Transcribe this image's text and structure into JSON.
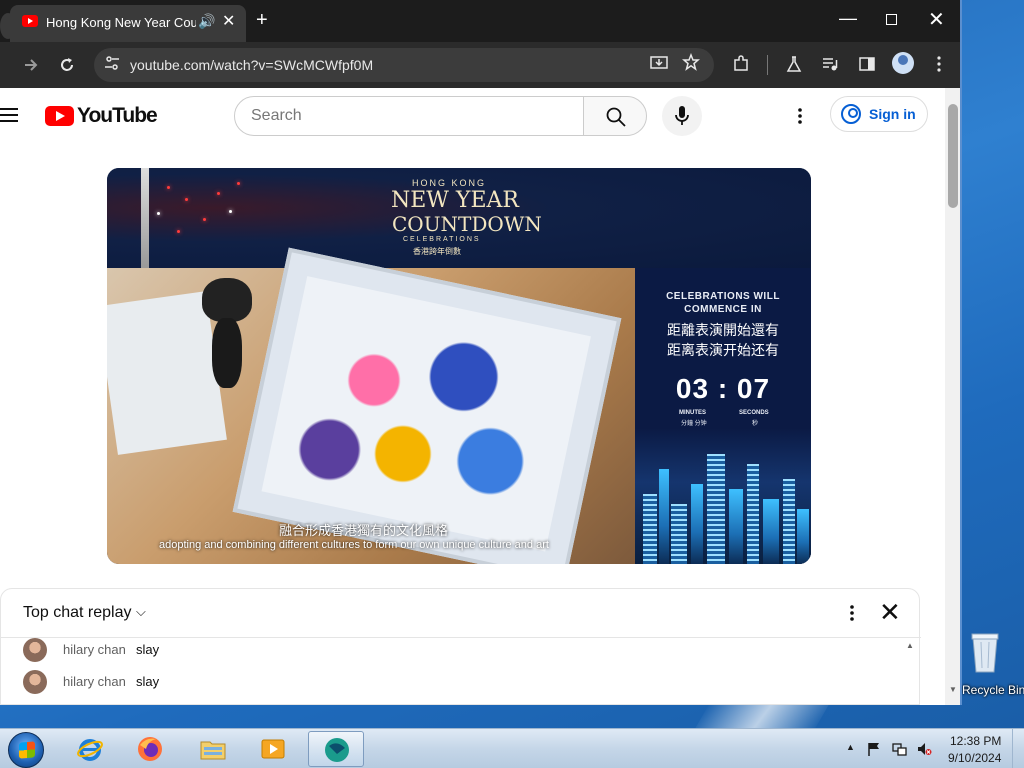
{
  "browser": {
    "tab_title": "Hong Kong New Year Coun",
    "tab_audio": "🔊",
    "tab_close": "✕",
    "new_tab": "+",
    "url": "youtube.com/watch?v=SWcMCWfpf0M",
    "window_min": "—",
    "window_close": "✕"
  },
  "youtube": {
    "wordmark": "YouTube",
    "search_placeholder": "Search",
    "signin_label": "Sign in"
  },
  "video": {
    "overlay_small": "HONG KONG",
    "overlay_title_1": "NEW YEAR",
    "overlay_title_2": "COUNTDOWN",
    "overlay_celebrations": "CELEBRATIONS",
    "overlay_cn": "香港跨年倒數",
    "countdown_en": "CELEBRATIONS WILL COMMENCE IN",
    "countdown_tc": "距離表演開始還有",
    "countdown_sc": "距离表演开始还有",
    "countdown_time": "03 : 07",
    "minutes_label": "MINUTES",
    "seconds_label": "SECONDS",
    "minutes_cn": "分鐘 分钟",
    "seconds_cn": "秒",
    "subtitle_cn": "融合形成香港獨有的文化風格",
    "subtitle_en": "adopting and combining different cultures to form our own unique culture and art"
  },
  "chat": {
    "title": "Top chat replay",
    "chevron": "⌵",
    "close": "✕",
    "messages": [
      {
        "author": "hilary chan",
        "text": "slay"
      },
      {
        "author": "hilary chan",
        "text": "slay"
      }
    ]
  },
  "desktop": {
    "recycle_label": "Recycle Bin"
  },
  "taskbar": {
    "time": "12:38 PM",
    "date": "9/10/2024",
    "tray_arrow": "▲"
  },
  "colors": {
    "youtube_red": "#ff0000",
    "link_blue": "#065fd4",
    "chrome_dark": "#2b2b2b"
  }
}
